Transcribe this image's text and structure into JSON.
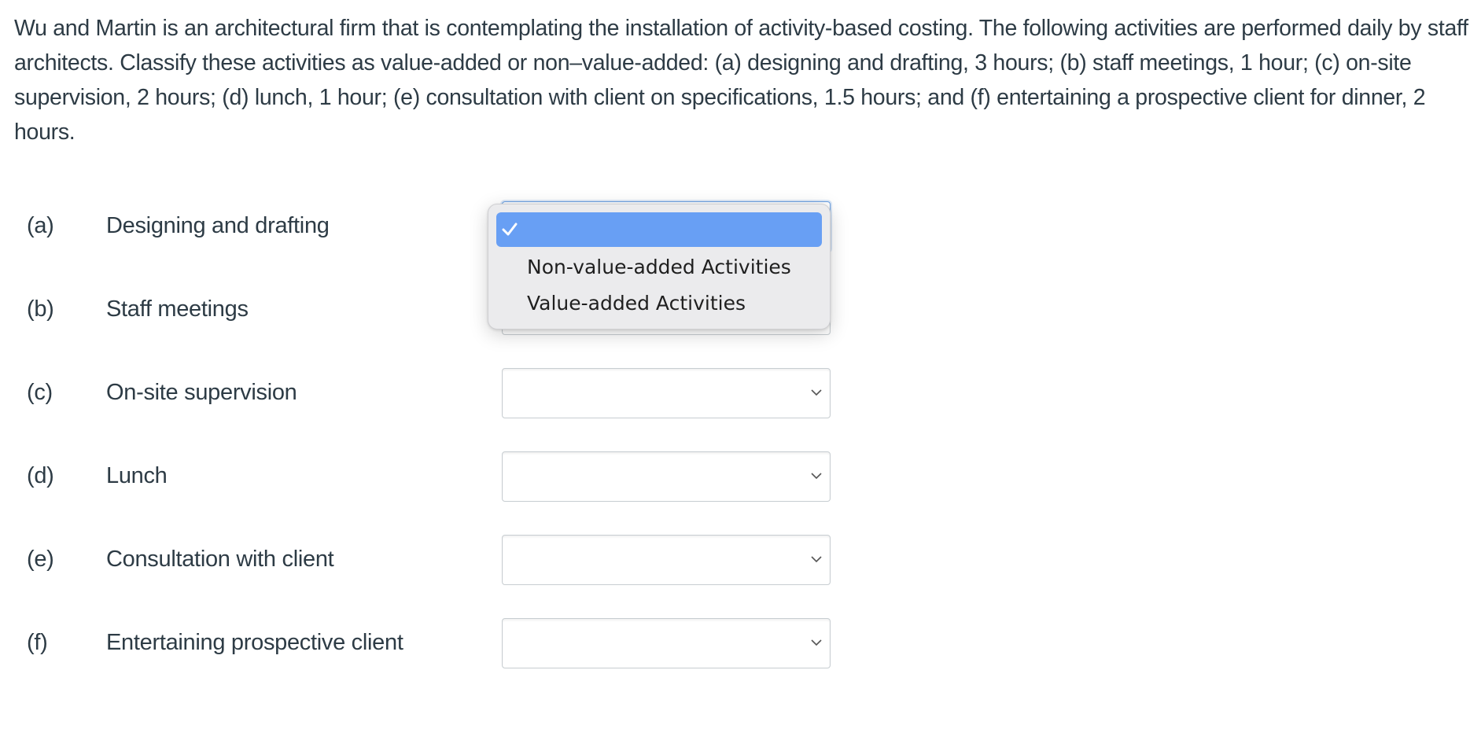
{
  "question": {
    "text": "Wu and Martin is an architectural firm that is contemplating the installation of activity-based costing. The following activities are performed daily by staff architects. Classify these activities as value-added or non–value-added: (a) designing and drafting, 3 hours; (b) staff meetings, 1 hour; (c) on-site supervision, 2 hours; (d) lunch, 1 hour; (e) consultation with client on specifications, 1.5 hours; and (f) entertaining a prospective client for dinner, 2 hours."
  },
  "rows": [
    {
      "letter": "(a)",
      "activity": "Designing and drafting",
      "selected": ""
    },
    {
      "letter": "(b)",
      "activity": "Staff meetings",
      "selected": ""
    },
    {
      "letter": "(c)",
      "activity": "On-site supervision",
      "selected": ""
    },
    {
      "letter": "(d)",
      "activity": "Lunch",
      "selected": ""
    },
    {
      "letter": "(e)",
      "activity": "Consultation with client",
      "selected": ""
    },
    {
      "letter": "(f)",
      "activity": "Entertaining prospective client",
      "selected": ""
    }
  ],
  "dropdown": {
    "open_for_row": "(a)",
    "options": [
      {
        "label": "",
        "checked": true
      },
      {
        "label": "Non-value-added Activities",
        "checked": false
      },
      {
        "label": "Value-added Activities",
        "checked": false
      }
    ]
  },
  "colors": {
    "text": "#2d3b45",
    "highlight": "#689ff4",
    "focus_border": "#6a9fe0",
    "popup_bg": "#ebebed"
  },
  "icons": {
    "chevron": "chevron-down-icon",
    "check": "checkmark-icon"
  }
}
